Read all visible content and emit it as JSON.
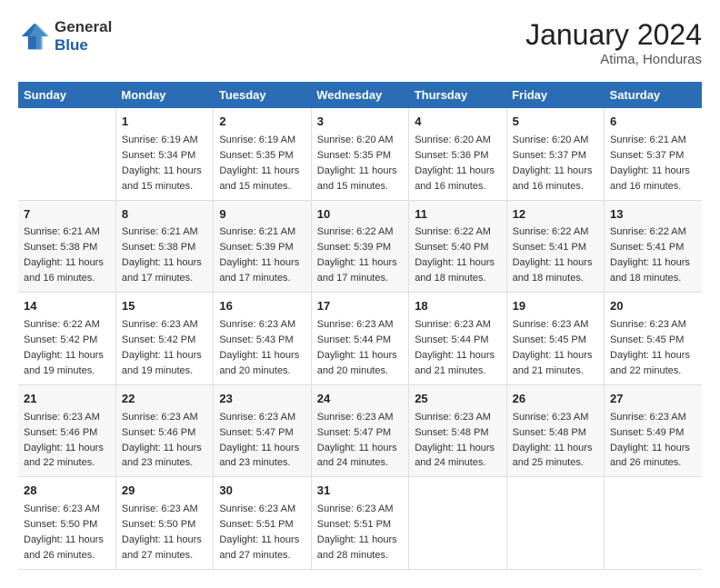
{
  "header": {
    "logo_general": "General",
    "logo_blue": "Blue",
    "month_year": "January 2024",
    "location": "Atima, Honduras"
  },
  "weekdays": [
    "Sunday",
    "Monday",
    "Tuesday",
    "Wednesday",
    "Thursday",
    "Friday",
    "Saturday"
  ],
  "weeks": [
    [
      {
        "day": "",
        "sunrise": "",
        "sunset": "",
        "daylight": ""
      },
      {
        "day": "1",
        "sunrise": "Sunrise: 6:19 AM",
        "sunset": "Sunset: 5:34 PM",
        "daylight": "Daylight: 11 hours and 15 minutes."
      },
      {
        "day": "2",
        "sunrise": "Sunrise: 6:19 AM",
        "sunset": "Sunset: 5:35 PM",
        "daylight": "Daylight: 11 hours and 15 minutes."
      },
      {
        "day": "3",
        "sunrise": "Sunrise: 6:20 AM",
        "sunset": "Sunset: 5:35 PM",
        "daylight": "Daylight: 11 hours and 15 minutes."
      },
      {
        "day": "4",
        "sunrise": "Sunrise: 6:20 AM",
        "sunset": "Sunset: 5:36 PM",
        "daylight": "Daylight: 11 hours and 16 minutes."
      },
      {
        "day": "5",
        "sunrise": "Sunrise: 6:20 AM",
        "sunset": "Sunset: 5:37 PM",
        "daylight": "Daylight: 11 hours and 16 minutes."
      },
      {
        "day": "6",
        "sunrise": "Sunrise: 6:21 AM",
        "sunset": "Sunset: 5:37 PM",
        "daylight": "Daylight: 11 hours and 16 minutes."
      }
    ],
    [
      {
        "day": "7",
        "sunrise": "Sunrise: 6:21 AM",
        "sunset": "Sunset: 5:38 PM",
        "daylight": "Daylight: 11 hours and 16 minutes."
      },
      {
        "day": "8",
        "sunrise": "Sunrise: 6:21 AM",
        "sunset": "Sunset: 5:38 PM",
        "daylight": "Daylight: 11 hours and 17 minutes."
      },
      {
        "day": "9",
        "sunrise": "Sunrise: 6:21 AM",
        "sunset": "Sunset: 5:39 PM",
        "daylight": "Daylight: 11 hours and 17 minutes."
      },
      {
        "day": "10",
        "sunrise": "Sunrise: 6:22 AM",
        "sunset": "Sunset: 5:39 PM",
        "daylight": "Daylight: 11 hours and 17 minutes."
      },
      {
        "day": "11",
        "sunrise": "Sunrise: 6:22 AM",
        "sunset": "Sunset: 5:40 PM",
        "daylight": "Daylight: 11 hours and 18 minutes."
      },
      {
        "day": "12",
        "sunrise": "Sunrise: 6:22 AM",
        "sunset": "Sunset: 5:41 PM",
        "daylight": "Daylight: 11 hours and 18 minutes."
      },
      {
        "day": "13",
        "sunrise": "Sunrise: 6:22 AM",
        "sunset": "Sunset: 5:41 PM",
        "daylight": "Daylight: 11 hours and 18 minutes."
      }
    ],
    [
      {
        "day": "14",
        "sunrise": "Sunrise: 6:22 AM",
        "sunset": "Sunset: 5:42 PM",
        "daylight": "Daylight: 11 hours and 19 minutes."
      },
      {
        "day": "15",
        "sunrise": "Sunrise: 6:23 AM",
        "sunset": "Sunset: 5:42 PM",
        "daylight": "Daylight: 11 hours and 19 minutes."
      },
      {
        "day": "16",
        "sunrise": "Sunrise: 6:23 AM",
        "sunset": "Sunset: 5:43 PM",
        "daylight": "Daylight: 11 hours and 20 minutes."
      },
      {
        "day": "17",
        "sunrise": "Sunrise: 6:23 AM",
        "sunset": "Sunset: 5:44 PM",
        "daylight": "Daylight: 11 hours and 20 minutes."
      },
      {
        "day": "18",
        "sunrise": "Sunrise: 6:23 AM",
        "sunset": "Sunset: 5:44 PM",
        "daylight": "Daylight: 11 hours and 21 minutes."
      },
      {
        "day": "19",
        "sunrise": "Sunrise: 6:23 AM",
        "sunset": "Sunset: 5:45 PM",
        "daylight": "Daylight: 11 hours and 21 minutes."
      },
      {
        "day": "20",
        "sunrise": "Sunrise: 6:23 AM",
        "sunset": "Sunset: 5:45 PM",
        "daylight": "Daylight: 11 hours and 22 minutes."
      }
    ],
    [
      {
        "day": "21",
        "sunrise": "Sunrise: 6:23 AM",
        "sunset": "Sunset: 5:46 PM",
        "daylight": "Daylight: 11 hours and 22 minutes."
      },
      {
        "day": "22",
        "sunrise": "Sunrise: 6:23 AM",
        "sunset": "Sunset: 5:46 PM",
        "daylight": "Daylight: 11 hours and 23 minutes."
      },
      {
        "day": "23",
        "sunrise": "Sunrise: 6:23 AM",
        "sunset": "Sunset: 5:47 PM",
        "daylight": "Daylight: 11 hours and 23 minutes."
      },
      {
        "day": "24",
        "sunrise": "Sunrise: 6:23 AM",
        "sunset": "Sunset: 5:47 PM",
        "daylight": "Daylight: 11 hours and 24 minutes."
      },
      {
        "day": "25",
        "sunrise": "Sunrise: 6:23 AM",
        "sunset": "Sunset: 5:48 PM",
        "daylight": "Daylight: 11 hours and 24 minutes."
      },
      {
        "day": "26",
        "sunrise": "Sunrise: 6:23 AM",
        "sunset": "Sunset: 5:48 PM",
        "daylight": "Daylight: 11 hours and 25 minutes."
      },
      {
        "day": "27",
        "sunrise": "Sunrise: 6:23 AM",
        "sunset": "Sunset: 5:49 PM",
        "daylight": "Daylight: 11 hours and 26 minutes."
      }
    ],
    [
      {
        "day": "28",
        "sunrise": "Sunrise: 6:23 AM",
        "sunset": "Sunset: 5:50 PM",
        "daylight": "Daylight: 11 hours and 26 minutes."
      },
      {
        "day": "29",
        "sunrise": "Sunrise: 6:23 AM",
        "sunset": "Sunset: 5:50 PM",
        "daylight": "Daylight: 11 hours and 27 minutes."
      },
      {
        "day": "30",
        "sunrise": "Sunrise: 6:23 AM",
        "sunset": "Sunset: 5:51 PM",
        "daylight": "Daylight: 11 hours and 27 minutes."
      },
      {
        "day": "31",
        "sunrise": "Sunrise: 6:23 AM",
        "sunset": "Sunset: 5:51 PM",
        "daylight": "Daylight: 11 hours and 28 minutes."
      },
      {
        "day": "",
        "sunrise": "",
        "sunset": "",
        "daylight": ""
      },
      {
        "day": "",
        "sunrise": "",
        "sunset": "",
        "daylight": ""
      },
      {
        "day": "",
        "sunrise": "",
        "sunset": "",
        "daylight": ""
      }
    ]
  ]
}
